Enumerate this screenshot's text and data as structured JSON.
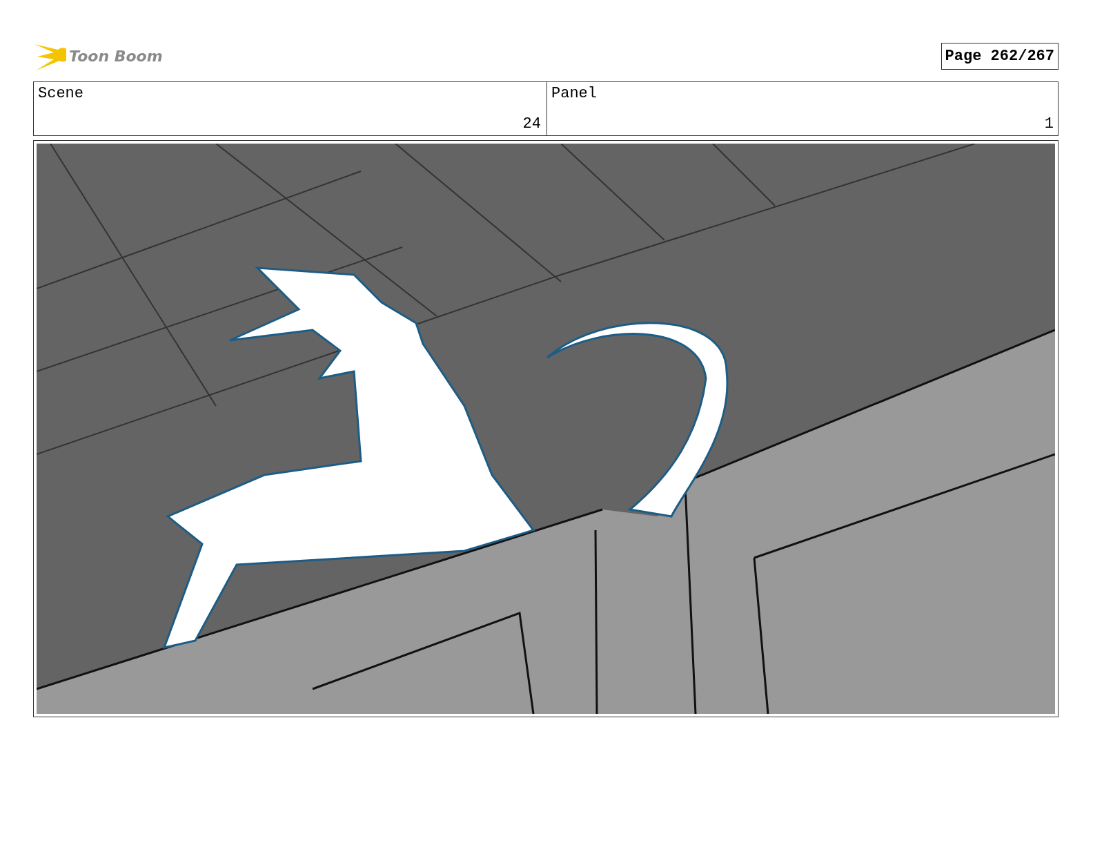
{
  "header": {
    "logo": "Toon Boom",
    "page": "Page 262/267"
  },
  "fields": [
    {
      "label": "Scene",
      "number": "24"
    },
    {
      "label": "Panel",
      "number": "1"
    }
  ]
}
